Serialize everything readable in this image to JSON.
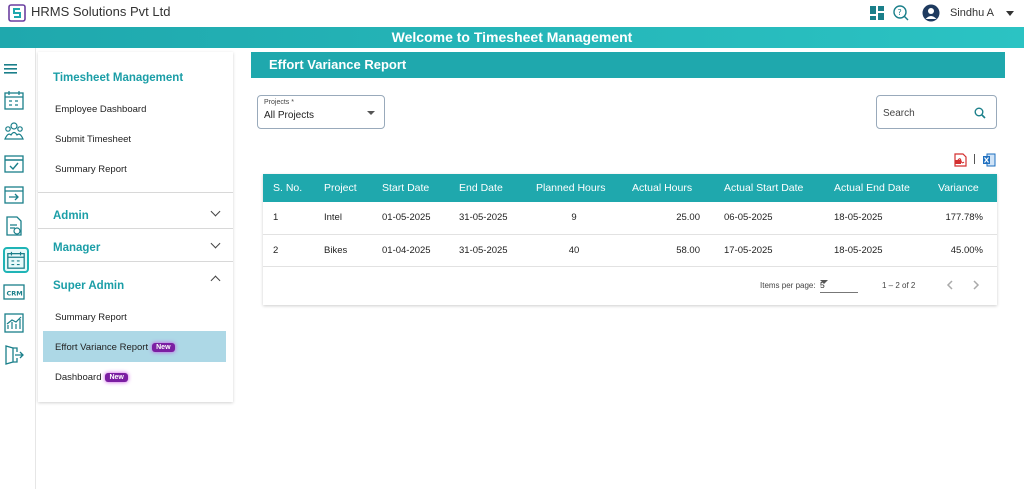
{
  "app": {
    "company": "HRMS Solutions Pvt Ltd",
    "user": "Sindhu A"
  },
  "banner": {
    "title": "Welcome to Timesheet Management"
  },
  "sidebar": {
    "timesheet_title": "Timesheet Management",
    "employee_dashboard": "Employee Dashboard",
    "submit_timesheet": "Submit Timesheet",
    "summary_report": "Summary Report",
    "admin": "Admin",
    "manager": "Manager",
    "super_admin": "Super Admin",
    "sa_summary_report": "Summary Report",
    "sa_effort_variance": "Effort Variance Report",
    "sa_dashboard": "Dashboard",
    "badge_new": "New"
  },
  "report": {
    "title": "Effort Variance Report",
    "projects_label": "Projects *",
    "projects_value": "All Projects",
    "search_placeholder": "Search"
  },
  "table": {
    "headers": [
      "S. No.",
      "Project",
      "Start Date",
      "End Date",
      "Planned Hours",
      "Actual Hours",
      "Actual Start Date",
      "Actual End Date",
      "Variance"
    ],
    "rows": [
      [
        "1",
        "Intel",
        "01-05-2025",
        "31-05-2025",
        "9",
        "25.00",
        "06-05-2025",
        "18-05-2025",
        "177.78%"
      ],
      [
        "2",
        "Bikes",
        "01-04-2025",
        "31-05-2025",
        "40",
        "58.00",
        "17-05-2025",
        "18-05-2025",
        "45.00%"
      ]
    ]
  },
  "pager": {
    "items_label": "Items per page:",
    "items_value": "5",
    "range": "1 – 2 of 2"
  },
  "colors": {
    "teal": "#1fa8ad",
    "badge": "#7b1ea2",
    "active_row": "#add8e6"
  }
}
